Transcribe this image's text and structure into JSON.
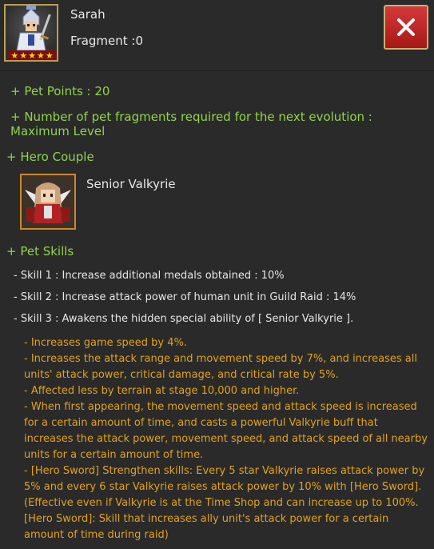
{
  "pet": {
    "name": "Sarah",
    "fragment_label": "Fragment :",
    "fragment_value": "0",
    "stars": 5
  },
  "info": {
    "pet_points": "+ Pet Points : 20",
    "fragments_required_line1": "+ Number of pet fragments required for the next evolution :",
    "fragments_required_line2": "Maximum Level"
  },
  "hero_couple": {
    "heading": "+ Hero Couple",
    "hero_name": "Senior Valkyrie"
  },
  "pet_skills": {
    "heading": "+ Pet Skills",
    "skills": [
      "- Skill 1 : Increase additional medals obtained : 10%",
      "- Skill 2 : Increase attack power of human unit in Guild Raid : 14%",
      "- Skill 3 : Awakens the hidden special ability of [ Senior Valkyrie ]."
    ],
    "skill3_details": [
      "- Increases game speed by 4%.",
      "- Increases the attack range and movement speed by 7%, and increases all",
      "units' attack power, critical damage, and critical rate by 5%.",
      "- Affected less by terrain at stage 10,000 and higher.",
      "- When first appearing, the movement speed and attack speed is increased",
      "for a certain amount of time, and casts a powerful Valkyrie buff that",
      "increases the attack power, movement speed, and attack speed of all nearby",
      "units for a certain amount of time.",
      "- [Hero Sword] Strengthen skills: Every 5 star Valkyrie raises attack power by",
      "5% and every 6 star Valkyrie raises attack power by 10% with [Hero Sword].",
      "(Effective even if Valkyrie is at the Time Shop and can increase up to 100%.",
      "[Hero Sword]: Skill that increases ally unit's attack power for a certain",
      "amount of time during raid)"
    ]
  },
  "colors": {
    "background": "#2a2a2a",
    "heading_green": "#8fd44a",
    "detail_orange": "#e3a21a",
    "close_red": "#c62828"
  },
  "icons": {
    "close": "close-icon",
    "pet_portrait": "pet-portrait-icon",
    "hero_portrait": "hero-portrait-icon",
    "star": "star-icon"
  }
}
